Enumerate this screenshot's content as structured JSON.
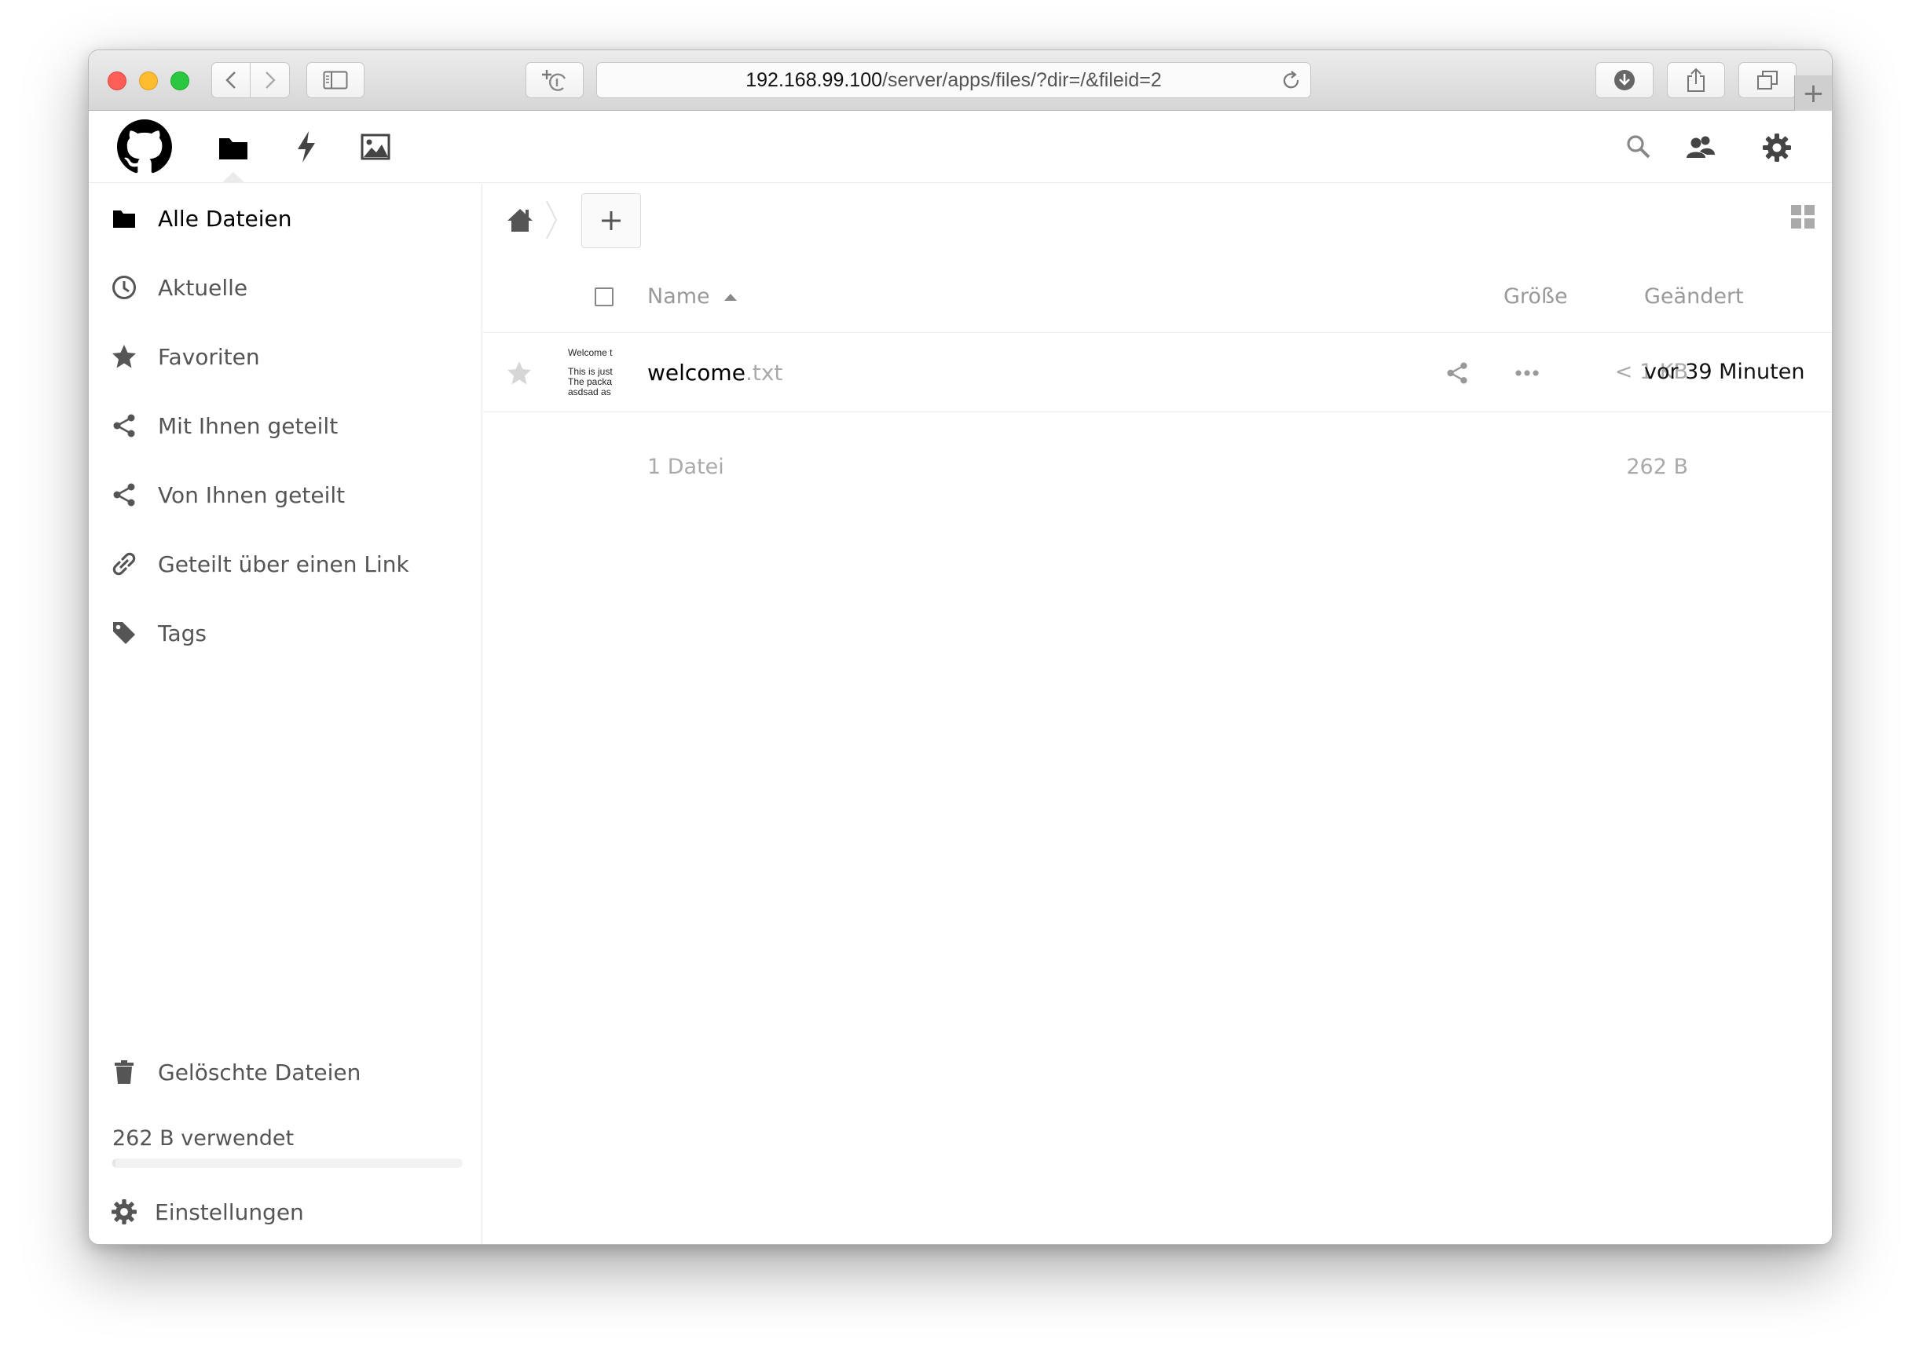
{
  "browser": {
    "url_host": "192.168.99.100",
    "url_path": "/server/apps/files/?dir=/&fileid=2",
    "new_tab_label": "+"
  },
  "sidebar": {
    "items": [
      {
        "label": "Alle Dateien",
        "icon": "folder-icon"
      },
      {
        "label": "Aktuelle",
        "icon": "clock-icon"
      },
      {
        "label": "Favoriten",
        "icon": "star-icon"
      },
      {
        "label": "Mit Ihnen geteilt",
        "icon": "share-icon"
      },
      {
        "label": "Von Ihnen geteilt",
        "icon": "share-icon"
      },
      {
        "label": "Geteilt über einen Link",
        "icon": "link-icon"
      },
      {
        "label": "Tags",
        "icon": "tag-icon"
      }
    ],
    "trash_label": "Gelöschte Dateien",
    "quota_label": "262 B verwendet",
    "quota_fraction": 0.01,
    "settings_label": "Einstellungen"
  },
  "table": {
    "headers": {
      "name": "Name",
      "size": "Größe",
      "modified": "Geändert"
    },
    "rows": [
      {
        "name": "welcome",
        "ext": ".txt",
        "thumb_lines": [
          "Welcome t",
          "This is just",
          "The packa",
          "asdsad as"
        ],
        "size": "< 1 KB",
        "modified": "vor 39 Minuten"
      }
    ],
    "summary_count": "1 Datei",
    "summary_size": "262 B"
  },
  "new_button_label": "+",
  "colors": {
    "accent": "#000000",
    "muted": "#999999",
    "icon": "#555555"
  }
}
